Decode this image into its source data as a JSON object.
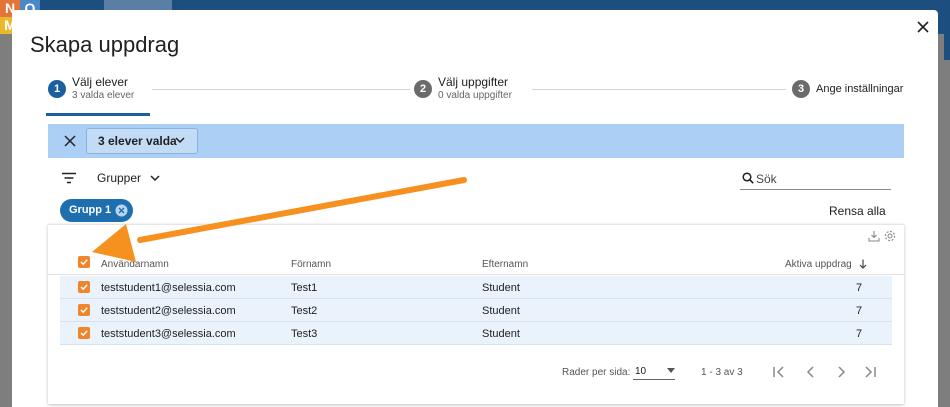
{
  "background": {
    "logo_letters": [
      "N",
      "O",
      "M"
    ]
  },
  "modal": {
    "title": "Skapa uppdrag",
    "close_icon": "close-icon"
  },
  "stepper": {
    "steps": [
      {
        "number": "1",
        "title": "Välj elever",
        "subtitle": "3 valda elever",
        "active": true
      },
      {
        "number": "2",
        "title": "Välj uppgifter",
        "subtitle": "0 valda uppgifter",
        "active": false
      },
      {
        "number": "3",
        "title": "Ange inställningar",
        "subtitle": "",
        "active": false
      }
    ]
  },
  "selection_bar": {
    "label": "3 elever valda"
  },
  "filters": {
    "groups_label": "Grupper",
    "search_placeholder": "Sök",
    "search_value": "",
    "active_chip": "Grupp 1",
    "clear_all": "Rensa alla"
  },
  "table": {
    "columns": [
      "Användarnamn",
      "Förnamn",
      "Efternamn",
      "Aktiva uppdrag"
    ],
    "sort_column": "Aktiva uppdrag",
    "sort_direction": "desc",
    "rows": [
      {
        "username": "teststudent1@selessia.com",
        "first": "Test1",
        "last": "Student",
        "active": "7",
        "checked": true
      },
      {
        "username": "teststudent2@selessia.com",
        "first": "Test2",
        "last": "Student",
        "active": "7",
        "checked": true
      },
      {
        "username": "teststudent3@selessia.com",
        "first": "Test3",
        "last": "Student",
        "active": "7",
        "checked": true
      }
    ],
    "select_all_checked": true
  },
  "pagination": {
    "rows_per_page_label": "Rader per sida:",
    "rows_per_page": "10",
    "range": "1 - 3 av 3"
  },
  "colors": {
    "primary": "#1d6fb0",
    "checkbox": "#f0852c",
    "selection_bar": "#acd0f5",
    "annotation_arrow": "#f6901e"
  }
}
